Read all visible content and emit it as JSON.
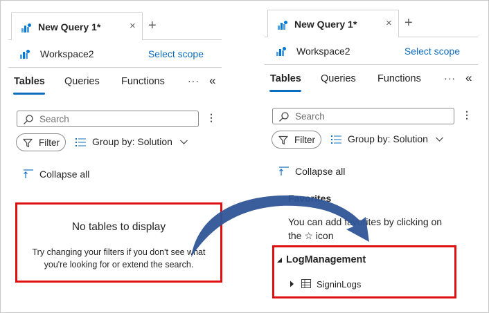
{
  "left_panel": {
    "query_tab": {
      "title": "New Query 1*",
      "close": "×"
    },
    "new_tab": "+",
    "workspace": {
      "name": "Workspace2",
      "select_scope": "Select scope"
    },
    "nav": {
      "tables": "Tables",
      "queries": "Queries",
      "functions": "Functions",
      "more": "···",
      "collapse": "«"
    },
    "search": {
      "placeholder": "Search"
    },
    "kebab": "⋮",
    "filter_label": "Filter",
    "group_by": "Group by: Solution",
    "collapse_all": "Collapse all",
    "empty_state": {
      "title": "No tables to display",
      "description_line1": "Try changing your filters if you don't see what",
      "description_line2": "you're looking for or extend the search."
    }
  },
  "right_panel": {
    "query_tab": {
      "title": "New Query 1*",
      "close": "×"
    },
    "new_tab": "+",
    "workspace": {
      "name": "Workspace2",
      "select_scope": "Select scope"
    },
    "nav": {
      "tables": "Tables",
      "queries": "Queries",
      "functions": "Functions",
      "more": "···",
      "collapse": "«"
    },
    "search": {
      "placeholder": "Search"
    },
    "kebab": "⋮",
    "filter_label": "Filter",
    "group_by": "Group by: Solution",
    "collapse_all": "Collapse all",
    "favorites": {
      "title": "Favorites",
      "description_line1": "You can add favorites by clicking on",
      "description_line2": "the ☆ icon"
    },
    "tree": {
      "group": "LogManagement",
      "item": "SigninLogs"
    }
  },
  "colors": {
    "accent": "#0f6cbd",
    "highlight_box": "#e01010",
    "arrow": "#2f5597",
    "icon_blue": "#0078d4"
  },
  "icons": {
    "query": "log-analytics-icon",
    "workspace": "log-analytics-icon",
    "search": "search-icon",
    "filter": "filter-icon",
    "group": "list-icon",
    "chevron": "chevron-down-icon",
    "collapse_all": "collapse-all-icon",
    "tree_expand": "caret-right-icon",
    "tree_collapse": "caret-down-icon",
    "table": "table-icon"
  }
}
